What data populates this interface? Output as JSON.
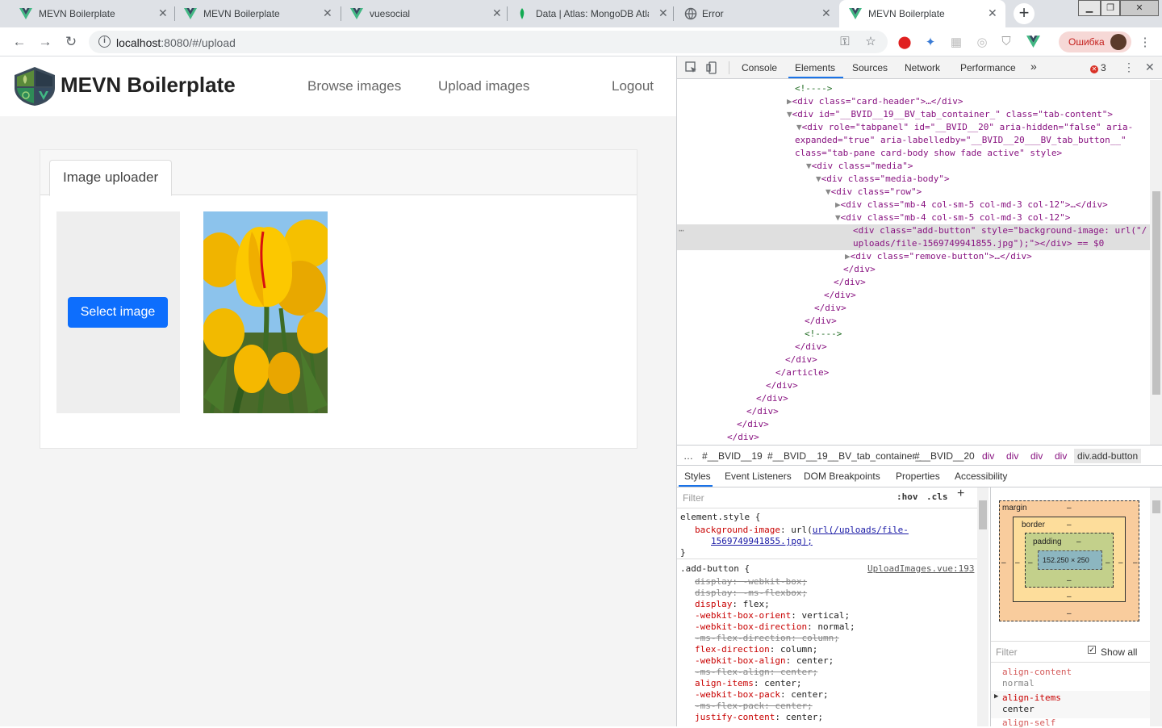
{
  "browser": {
    "tabs": [
      {
        "title": "MEVN Boilerplate",
        "icon": "vue-icon"
      },
      {
        "title": "MEVN Boilerplate",
        "icon": "vue-icon"
      },
      {
        "title": "vuesocial",
        "icon": "vue-icon"
      },
      {
        "title": "Data | Atlas: MongoDB Atla",
        "icon": "mongodb-leaf-icon"
      },
      {
        "title": "Error",
        "icon": "globe-icon"
      },
      {
        "title": "MEVN Boilerplate",
        "icon": "vue-icon",
        "active": true
      }
    ],
    "url_host": "localhost",
    "url_rest": ":8080/#/upload",
    "profile_label": "Ошибка"
  },
  "page": {
    "brand": "MEVN Boilerplate",
    "nav": {
      "browse": "Browse images",
      "upload": "Upload images",
      "logout": "Logout"
    },
    "card_tab": "Image uploader",
    "select_button": "Select image"
  },
  "devtools": {
    "tabs": [
      "Console",
      "Elements",
      "Sources",
      "Network",
      "Performance",
      "»"
    ],
    "active_tab": "Elements",
    "error_count": "3",
    "dom_lines": [
      "<!---->",
      "<div class=\"card-header\">…</div>",
      "<div id=\"__BVID__19__BV_tab_container_\" class=\"tab-content\">",
      "<div role=\"tabpanel\" id=\"__BVID__20\" aria-hidden=\"false\" aria-",
      "expanded=\"true\" aria-labelledby=\"__BVID__20___BV_tab_button__\"",
      "class=\"tab-pane card-body show fade active\" style>",
      "<div class=\"media\">",
      "<div class=\"media-body\">",
      "<div class=\"row\">",
      "<div class=\"mb-4 col-sm-5 col-md-3 col-12\">…</div>",
      "<div class=\"mb-4 col-sm-5 col-md-3 col-12\">",
      "<div class=\"add-button\" style=\"background-image: url(\"/",
      "uploads/file-1569749941855.jpg\");\"></div> == $0",
      "<div class=\"remove-button\">…</div>",
      "</div>",
      "</div>",
      "</div>",
      "</div>",
      "</div>",
      "<!---->",
      "</div>",
      "</div>",
      "</article>",
      "</div>",
      "</div>",
      "</div>",
      "</div>",
      "</div>"
    ],
    "breadcrumbs": [
      "…",
      "#__BVID__19",
      "#__BVID__19__BV_tab_container_",
      "#__BVID__20",
      "div",
      "div",
      "div",
      "div",
      "div.add-button"
    ],
    "style_tabs": [
      "Styles",
      "Event Listeners",
      "DOM Breakpoints",
      "Properties",
      "Accessibility"
    ],
    "filter_placeholder": "Filter",
    "hov": ":hov",
    "cls": ".cls",
    "element_style_selector": "element.style {",
    "element_style_prop": "background-image",
    "element_style_value_1": "url(/uploads/file-",
    "element_style_value_2": "1569749941855.jpg);",
    "close_brace": "}",
    "rule_selector": ".add-button {",
    "rule_source": "UploadImages.vue:193",
    "rule_props": [
      {
        "name": "display",
        "value": "-webkit-box;",
        "struck": true
      },
      {
        "name": "display",
        "value": "-ms-flexbox;",
        "struck": true
      },
      {
        "name": "display",
        "value": "flex;",
        "struck": false
      },
      {
        "name": "-webkit-box-orient",
        "value": "vertical;",
        "struck": false
      },
      {
        "name": "-webkit-box-direction",
        "value": "normal;",
        "struck": false
      },
      {
        "name": "-ms-flex-direction",
        "value": "column;",
        "struck": true
      },
      {
        "name": "flex-direction",
        "value": "column;",
        "struck": false
      },
      {
        "name": "-webkit-box-align",
        "value": "center;",
        "struck": false
      },
      {
        "name": "-ms-flex-align",
        "value": "center;",
        "struck": true
      },
      {
        "name": "align-items",
        "value": "center;",
        "struck": false
      },
      {
        "name": "-webkit-box-pack",
        "value": "center;",
        "struck": false
      },
      {
        "name": "-ms-flex-pack",
        "value": "center;",
        "struck": true
      },
      {
        "name": "justify-content",
        "value": "center;",
        "struck": false
      }
    ],
    "boxmodel": {
      "margin": "margin",
      "border": "border",
      "padding": "padding",
      "dash": "–",
      "content": "152.250 × 250"
    },
    "computed_filter": "Filter",
    "show_all": "Show all",
    "computed_props": [
      {
        "name": "align-content",
        "value": "normal"
      },
      {
        "name": "align-items",
        "value": "center"
      },
      {
        "name": "align-self",
        "value": ""
      }
    ]
  }
}
